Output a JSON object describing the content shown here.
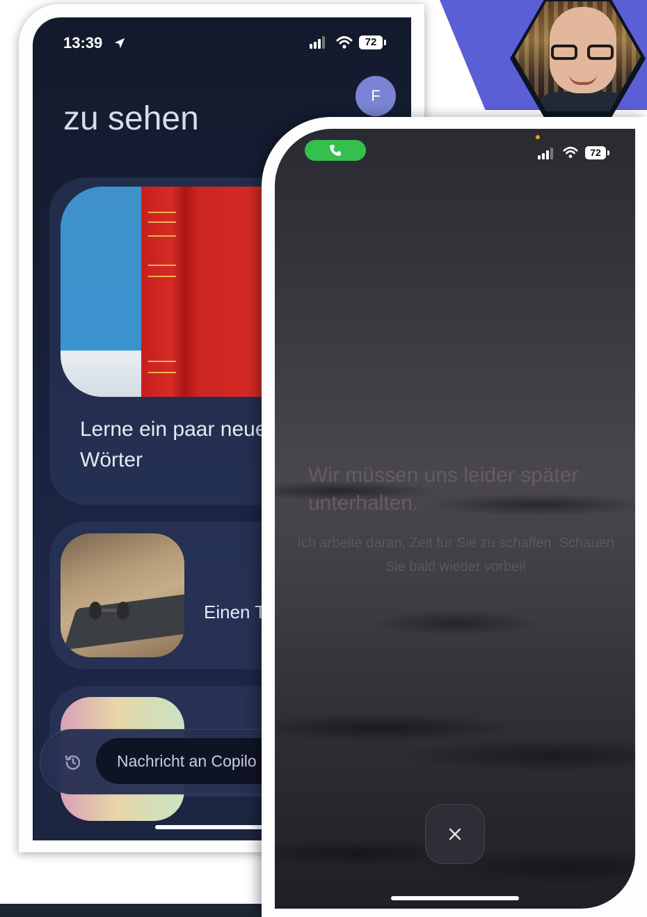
{
  "background_colors": {
    "accent": "#5b5fd6",
    "call_green": "#33c04d"
  },
  "phone_left": {
    "status": {
      "time": "13:39",
      "battery": "72"
    },
    "avatar_initial": "F",
    "heading": "zu sehen",
    "cards": [
      {
        "label": "Lerne ein paar neue Wörter",
        "icon": "book-image"
      },
      {
        "label": "Einen T erstelle",
        "icon": "dumbbell-image"
      },
      {
        "label": "",
        "icon": "gradient-image"
      }
    ],
    "composer": {
      "placeholder": "Nachricht an Copilo",
      "history_icon": "history-icon"
    }
  },
  "phone_right": {
    "status": {
      "battery": "72"
    },
    "message": {
      "title": "Wir müssen uns leider später unterhalten.",
      "subtitle": "Ich arbeite daran, Zeit für Sie zu schaffen. Schauen Sie bald wieder vorbei!"
    },
    "close_icon": "close-icon"
  }
}
